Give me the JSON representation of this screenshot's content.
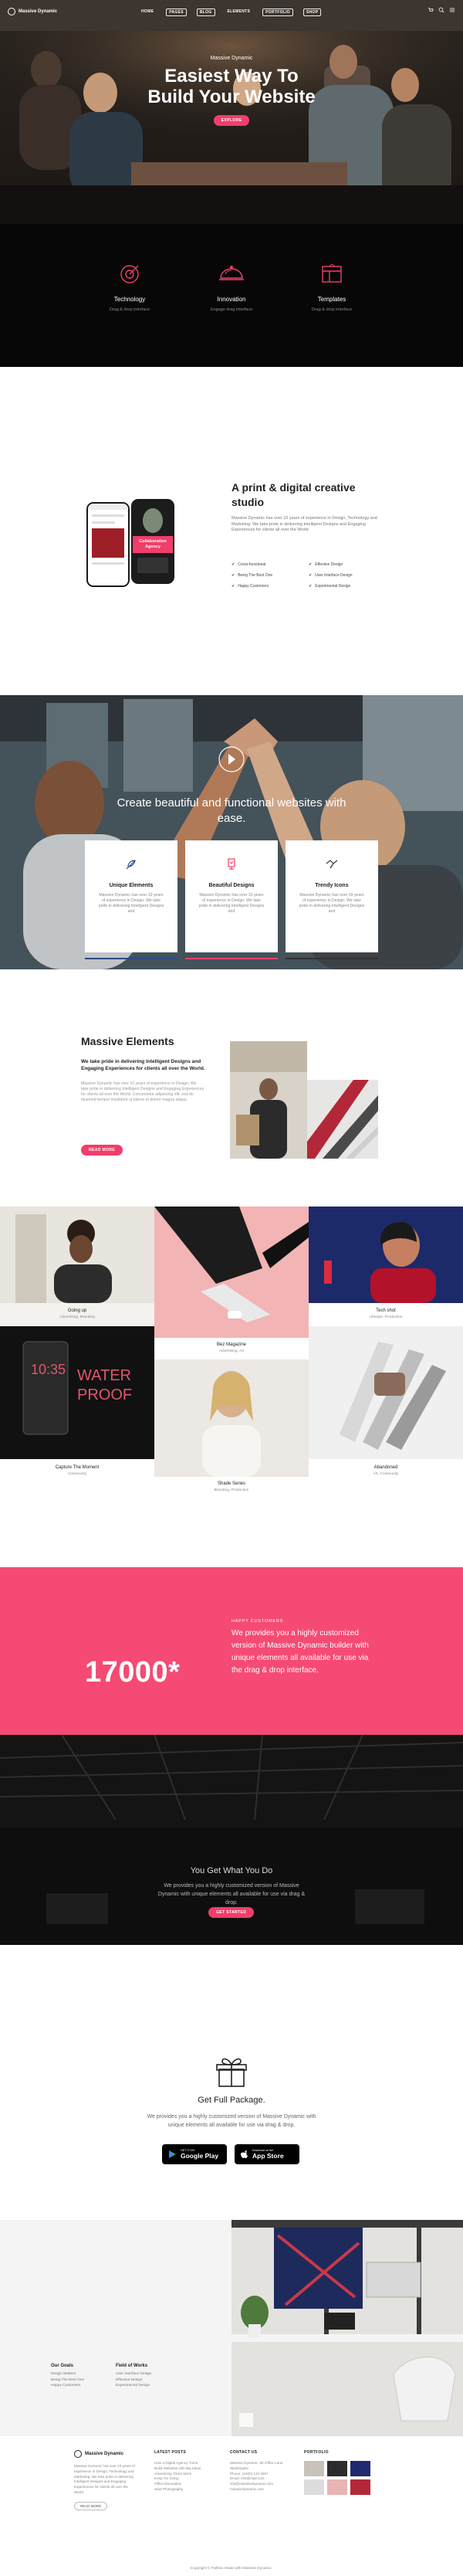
{
  "brand": {
    "name": "Massive Dynamic",
    "accent": "#f03e6a"
  },
  "nav": {
    "items": [
      "HOME",
      "PAGES",
      "BLOG",
      "ELEMENTS",
      "PORTFOLIO",
      "SHOP"
    ],
    "icons": [
      "cart-icon",
      "search-icon",
      "menu-icon"
    ]
  },
  "hero": {
    "kicker": "Massive Dynamic",
    "title": "Easiest Way To Build Your Website",
    "button": "EXPLORE"
  },
  "features": [
    {
      "icon": "target-icon",
      "title": "Technology",
      "desc": "Drag & drop interface"
    },
    {
      "icon": "dish-icon",
      "title": "Innovation",
      "desc": "Engage drag interface"
    },
    {
      "icon": "layout-icon",
      "title": "Templates",
      "desc": "Drag & drop interface"
    }
  ],
  "print": {
    "title": "A print & digital creative studio",
    "body": "Massive Dynamic has over 10 years of experience in Design, Technology and Marketing. We take pride in delivering Intelligent Designs and Engaging Experiences for clients all over the World.",
    "phone_text": "Collaboration Agency",
    "checks": [
      "Cross-functional",
      "Effective Design",
      "Being The Best One",
      "User Interface Design",
      "Happy Customers",
      "Experimental Design"
    ]
  },
  "team": {
    "caption": "Create beautiful and functional websites with ease."
  },
  "cards": [
    {
      "icon": "feather-icon",
      "title": "Unique Elements",
      "desc": "Massive Dynamic has over 10 years of experience in Design. We take pride in delivering Intelligent Designs and",
      "bar": "#2c4a8a"
    },
    {
      "icon": "trophy-icon",
      "title": "Beautiful Designs",
      "desc": "Massive Dynamic has over 10 years of experience in Design. We take pride in delivering Intelligent Designs and",
      "bar": "#f03e6a"
    },
    {
      "icon": "zap-icon",
      "title": "Trendy Icons",
      "desc": "Massive Dynamic has over 10 years of experience in Design. We take pride in delivering Intelligent Designs and",
      "bar": "#333333"
    }
  ],
  "massive": {
    "title": "Massive Elements",
    "lead": "We take pride in delivering Intelligent Designs and Engaging Experiences for clients all over the World.",
    "body": "Massive Dynamic has over 10 years of experience in Design. We take pride in delivering Intelligent Designs and Engaging Experiences for clients all over the World. Consectetur adipiscing elit, sed do eiusmod tempor incididunt ut labore et dolore magna aliqua.",
    "button": "READ MORE"
  },
  "gallery": [
    {
      "name": "Going up",
      "cat": "Advertising, Branding"
    },
    {
      "name": "Bez Magazine",
      "cat": "Advertising, Art"
    },
    {
      "name": "Tech shot",
      "cat": "Lifestyle, Production"
    },
    {
      "name": "Capture The Moment",
      "cat": "Community"
    },
    {
      "name": "Shade Series",
      "cat": "Branding, Production"
    },
    {
      "name": "Abandoned",
      "cat": "Art, Community"
    }
  ],
  "gallery_phone_text": {
    "time": "10:35",
    "word1": "WATER",
    "word2": "PROOF"
  },
  "counter": {
    "number": "17000*",
    "label": "HAPPY CUSTOMERS",
    "text": "We provides you a highly customized version of Massive Dynamic builder with unique elements all available for use via the drag & drop interface."
  },
  "office": {
    "title": "You Get What You Do",
    "desc": "We provides you a highly customized version of Massive Dynamic with unique elements all available for use via drag & drop.",
    "button": "GET STARTED"
  },
  "package": {
    "title": "Get Full Package.",
    "desc": "We provides you a highly customized version of Massive Dynamic with unique elements all available for use via drag & drop.",
    "google_top": "GET IT ON",
    "google": "Google Play",
    "apple_top": "Download on the",
    "apple": "App Store"
  },
  "lists": [
    {
      "title": "Our Goals",
      "items": [
        "Desgin Matters",
        "Being The Best One",
        "Happy Customers"
      ]
    },
    {
      "title": "Field of Works",
      "items": [
        "User Interface Design",
        "Effective Design",
        "Experimental Design"
      ]
    }
  ],
  "footer": {
    "about": "Massive Dynamic has over 10 years of experience in Design, Technology and Marketing. We take pride in delivering Intelligent Designs and Engaging Experiences for clients all over the World.",
    "about_button": "READ MORE",
    "posts_title": "LATEST POSTS",
    "posts": [
      "How a Digital Agency Turns",
      "Build Websites with Big Ideas",
      "Advertising Tricks Work",
      "Keep On Going",
      "Office Decoration",
      "Start Photography"
    ],
    "contact_title": "CONTACT US",
    "contact": [
      "Massive Dynamic, 80 Office Lane",
      "Washington",
      "Phone: (1800) 123 4567",
      "Email: info@mail.com",
      "info@massivedynamic.com",
      "massivedynamic.com"
    ],
    "portfolio_title": "PORTFOLIO",
    "copyright": "Copyright © Pixflow. Made with Massive Dynamic."
  }
}
